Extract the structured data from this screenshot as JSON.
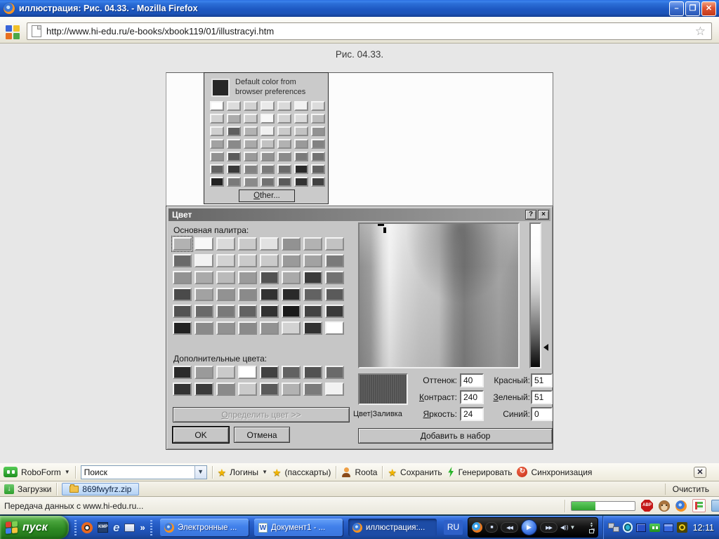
{
  "titlebar": {
    "title": "иллюстрация: Рис. 04.33. - Mozilla Firefox"
  },
  "navbar": {
    "url": "http://www.hi-edu.ru/e-books/xbook119/01/illustracyi.htm"
  },
  "page": {
    "caption": "Рис. 04.33."
  },
  "picker_dropdown": {
    "default_label": "Default color from browser preferences",
    "other": "Other...",
    "swatches": [
      "#ffffff",
      "#dcdcdc",
      "#d2d2d2",
      "#eaeaea",
      "#dadada",
      "#f2f2f2",
      "#dcdcdc",
      "#d2d2d2",
      "#ababab",
      "#cccccc",
      "#f8f8f8",
      "#d2d2d2",
      "#dadada",
      "#bcbcbc",
      "#cfcfcf",
      "#5f5f5f",
      "#b2b2b2",
      "#f0f0f0",
      "#cacaca",
      "#c2c2c2",
      "#929292",
      "#a2a2a2",
      "#8a8a8a",
      "#aaaaaa",
      "#c2c2c2",
      "#b2b2b2",
      "#9a9a9a",
      "#828282",
      "#929292",
      "#5a5a5a",
      "#9a9a9a",
      "#929292",
      "#8a8a8a",
      "#7a7a7a",
      "#727272",
      "#626262",
      "#3a3a3a",
      "#828282",
      "#7a7a7a",
      "#6a6a6a",
      "#2a2a2a",
      "#626262",
      "#222222",
      "#7a7a7a",
      "#8a8a8a",
      "#727272",
      "#5a5a5a",
      "#323232",
      "#424242"
    ]
  },
  "color_dialog": {
    "title": "Цвет",
    "help_glyph": "?",
    "close_glyph": "×",
    "basic_label": "Основная палитра:",
    "custom_label": "Дополнительные цвета:",
    "define": "Определить цвет >>",
    "ok": "OK",
    "cancel": "Отмена",
    "sample_label": "Цвет|Заливка",
    "sample_color": "#565656",
    "hue_label": "Оттенок:",
    "hue": "40",
    "contrast_label": "Контраст:",
    "contrast": "240",
    "brightness_label": "Яркость:",
    "brightness": "24",
    "red_label": "Красный:",
    "red": "51",
    "green_label": "Зеленый:",
    "green": "51",
    "blue_label": "Синий:",
    "blue": "0",
    "add": "Добавить в набор",
    "basic_swatches": [
      "#b2b2b2",
      "#f8f8f8",
      "#dadada",
      "#cacaca",
      "#e2e2e2",
      "#929292",
      "#b2b2b2",
      "#c2c2c2",
      "#6a6a6a",
      "#f2f2f2",
      "#d2d2d2",
      "#cacaca",
      "#cacaca",
      "#9a9a9a",
      "#a2a2a2",
      "#7a7a7a",
      "#929292",
      "#aaaaaa",
      "#bababa",
      "#9a9a9a",
      "#525252",
      "#aaaaaa",
      "#3a3a3a",
      "#727272",
      "#4a4a4a",
      "#a2a2a2",
      "#929292",
      "#8a8a8a",
      "#323232",
      "#2a2a2a",
      "#626262",
      "#5a5a5a",
      "#525252",
      "#6a6a6a",
      "#7a7a7a",
      "#626262",
      "#323232",
      "#1a1a1a",
      "#424242",
      "#3a3a3a",
      "#222222",
      "#8a8a8a",
      "#929292",
      "#8a8a8a",
      "#929292",
      "#d2d2d2",
      "#323232",
      "#ffffff"
    ],
    "custom_swatches": [
      "#2a2a2a",
      "#9a9a9a",
      "#cacaca",
      "#ffffff",
      "#424242",
      "#626262",
      "#525252",
      "#6a6a6a",
      "#323232",
      "#3a3a3a",
      "#8a8a8a",
      "#cacaca",
      "#5a5a5a",
      "#b2b2b2",
      "#7a7a7a",
      "#f2f2f2"
    ]
  },
  "roboform": {
    "brand": "RoboForm",
    "search": "Поиск",
    "logins": "Логины",
    "passcards": "(пасскарты)",
    "user": "Roota",
    "save": "Сохранить",
    "generate": "Генерировать",
    "sync": "Синхронизация"
  },
  "downloads": {
    "label": "Загрузки",
    "file": "869fwyfrz.zip",
    "clear": "Очистить"
  },
  "status": {
    "text": "Передача данных с www.hi-edu.ru...",
    "progress_pct": 38
  },
  "taskbar": {
    "start": "пуск",
    "quick_more": "»",
    "task1": "Электронные ...",
    "task2": "Документ1 - ...",
    "task3": "иллюстрация:...",
    "lang": "RU",
    "clock": "12:11"
  }
}
